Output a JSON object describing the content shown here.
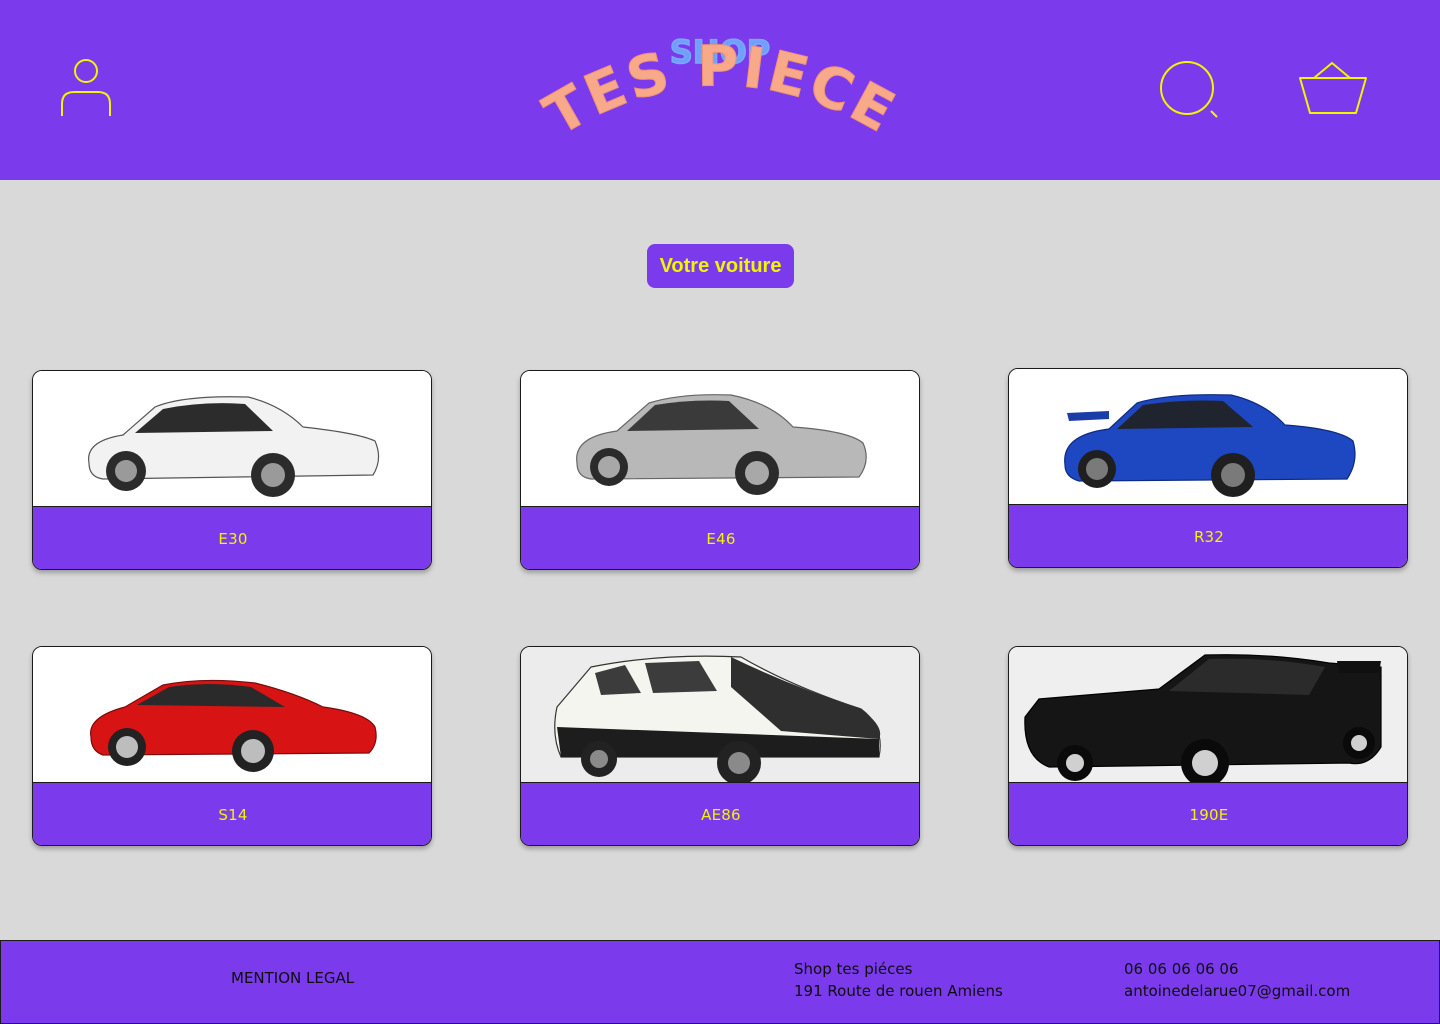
{
  "header": {
    "logo_top": "SHOP",
    "logo_main": "TES PIECE",
    "user_icon": "user-icon",
    "search_icon": "search-icon",
    "cart_icon": "basket-icon"
  },
  "main": {
    "title": "Votre voiture",
    "cars": [
      {
        "label": "E30",
        "color": "#f2f2f2"
      },
      {
        "label": "E46",
        "color": "#b8b8b8"
      },
      {
        "label": "R32",
        "color": "#1e47c2"
      },
      {
        "label": "S14",
        "color": "#d81313"
      },
      {
        "label": "AE86",
        "color": "#f5f5f0"
      },
      {
        "label": "190E",
        "color": "#151515"
      }
    ]
  },
  "footer": {
    "legal": "MENTION LEGAL",
    "shop_name": "Shop tes piéces",
    "shop_address": "191 Route de rouen Amiens",
    "phone": "06 06 06 06 06",
    "email": "antoinedelarue07@gmail.com"
  },
  "colors": {
    "brand": "#7c3aed",
    "accent": "#f1f500",
    "background": "#d9d9d9",
    "logo_main": "#f7a98a",
    "logo_top": "#6fa0ff"
  }
}
